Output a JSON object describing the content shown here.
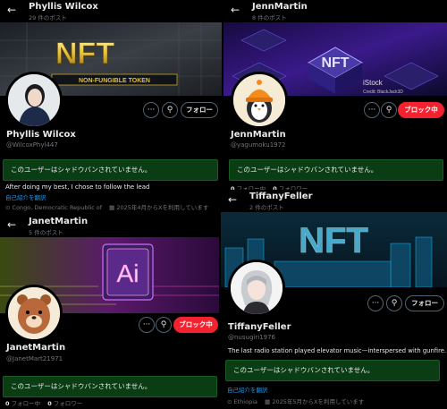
{
  "panels": [
    {
      "top_name": "Phyllis Wilcox",
      "post_count": "29 件のポスト",
      "banner_text": "NFT",
      "banner_subtext": "NON-FUNGIBLE TOKEN",
      "follow_label": "フォロー",
      "display_name": "Phyllis Wilcox",
      "handle": "@WilcoxPhyl447",
      "shadowban_text": "このユーザーはシャドウバンされていません。",
      "bio": "After doing my best, I chose to follow the lead",
      "translate_label": "自己紹介を翻訳",
      "location": "Congo, Democratic Republic of",
      "joined": "2025年4月からXを利用しています"
    },
    {
      "top_name": "JennMartin",
      "post_count": "8 件のポスト",
      "banner_text": "NFT",
      "watermark_main": "iStock",
      "watermark_sub": "Credit: BlackJack3D",
      "block_label": "ブロック中",
      "display_name": "JennMartin",
      "handle": "@yagumoku1972",
      "shadowban_text": "このユーザーはシャドウバンされていません。",
      "following_count": "0",
      "following_label": "フォロー中",
      "followers_count": "0",
      "followers_label": "フォロワー"
    },
    {
      "top_name": "JanetMartin",
      "post_count": "5 件のポスト",
      "banner_text": "Ai",
      "block_label": "ブロック中",
      "display_name": "JanetMartin",
      "handle": "@JanetMart21971",
      "shadowban_text": "このユーザーはシャドウバンされていません。",
      "following_count": "0",
      "following_label": "フォロー中",
      "followers_count": "0",
      "followers_label": "フォロワー"
    },
    {
      "top_name": "TiffanyFeller",
      "post_count": "2 件のポスト",
      "banner_text": "NFT",
      "follow_label": "フォロー",
      "display_name": "TiffanyFeller",
      "handle": "@nusugiri1976",
      "bio": "The last radio station played elevator music—interspersed with gunfire.",
      "shadowban_text": "このユーザーはシャドウバンされていません。",
      "translate_label": "自己紹介を翻訳",
      "location": "Ethiopia",
      "joined": "2025年5月からXを利用しています"
    }
  ],
  "icons": {
    "back": "←",
    "more": "···",
    "search": "⚲",
    "location": "location-pin-icon",
    "calendar": "calendar-icon"
  },
  "colors": {
    "background": "#000000",
    "shadowban_bg": "#0b3d14",
    "block_red": "#f4212e",
    "link_blue": "#1d9bf0",
    "muted": "#71767b"
  }
}
